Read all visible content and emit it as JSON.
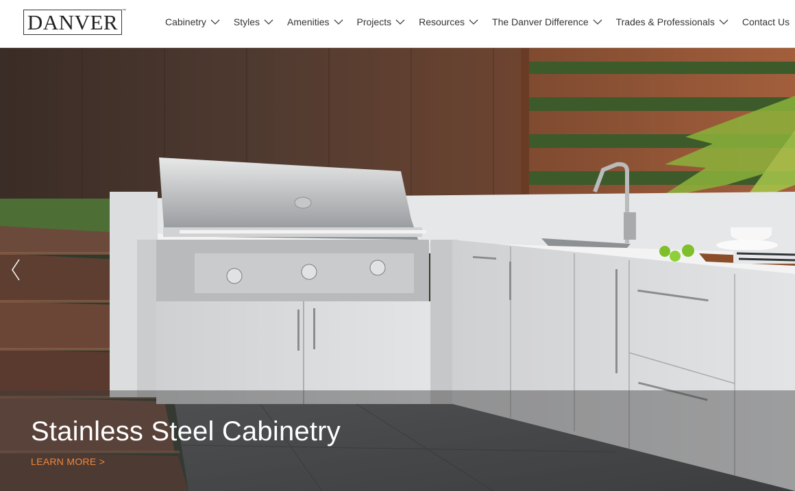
{
  "brand": {
    "logo_text": "DANVER",
    "trademark": "™"
  },
  "nav": {
    "items": [
      {
        "label": "Cabinetry",
        "has_dropdown": true
      },
      {
        "label": "Styles",
        "has_dropdown": true
      },
      {
        "label": "Amenities",
        "has_dropdown": true
      },
      {
        "label": "Projects",
        "has_dropdown": true
      },
      {
        "label": "Resources",
        "has_dropdown": true
      },
      {
        "label": "The Danver Difference",
        "has_dropdown": true
      },
      {
        "label": "Trades & Professionals",
        "has_dropdown": true
      },
      {
        "label": "Contact Us",
        "has_dropdown": false
      }
    ]
  },
  "hero": {
    "title": "Stainless Steel Cabinetry",
    "cta": "LEARN MORE >",
    "prev_icon": "chevron-left-icon"
  },
  "colors": {
    "cta": "#f0883a",
    "nav_text": "#333333",
    "wood_fence": "#7a4a32",
    "cabinet": "#d8d9db"
  }
}
